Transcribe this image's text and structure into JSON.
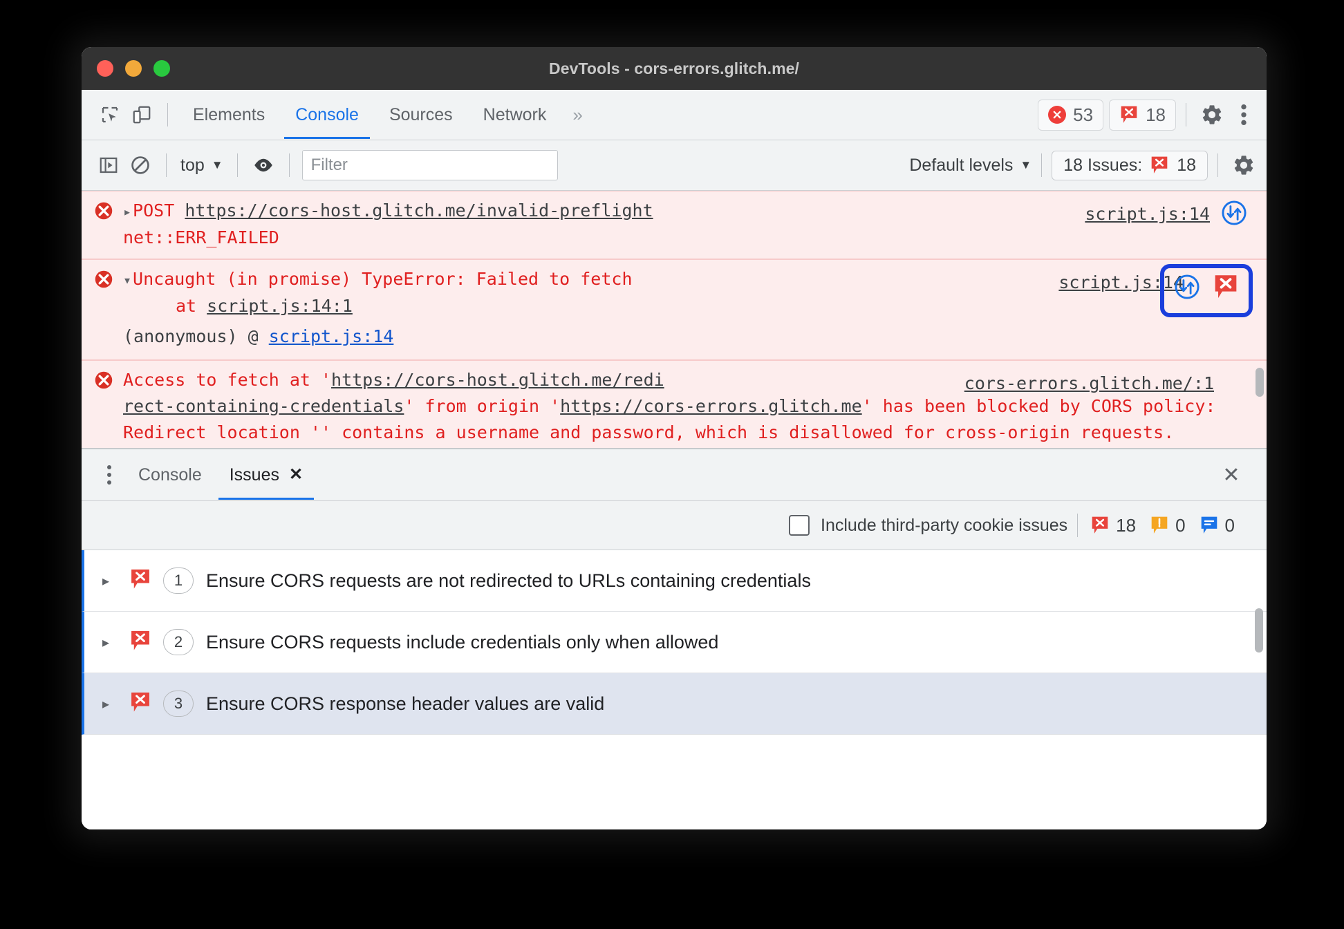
{
  "window": {
    "title": "DevTools - cors-errors.glitch.me/"
  },
  "main_tabs": {
    "items": [
      {
        "label": "Elements",
        "active": false
      },
      {
        "label": "Console",
        "active": true
      },
      {
        "label": "Sources",
        "active": false
      },
      {
        "label": "Network",
        "active": false
      }
    ],
    "overflow_label": "»",
    "error_count": "53",
    "issue_count": "18"
  },
  "console_toolbar": {
    "context": "top",
    "context_caret": "▼",
    "filter_placeholder": "Filter",
    "filter_value": "",
    "levels_label": "Default levels",
    "levels_caret": "▼",
    "issues_label": "18 Issues:",
    "issues_count": "18"
  },
  "console_messages": [
    {
      "expander": "▸",
      "method": "POST",
      "url": "https://cors-host.glitch.me/invalid-preflight",
      "detail": "net::ERR_FAILED",
      "source": "script.js:14"
    },
    {
      "expander": "▾",
      "text": "Uncaught (in promise) TypeError: Failed to fetch",
      "stack_prefix": "at",
      "stack_link": "script.js:14:1",
      "frame_label": "(anonymous) @",
      "frame_link": "script.js:14",
      "source": "script.js:14"
    },
    {
      "part1": "Access to fetch at '",
      "url_part1": "https://cors-host.glitch.me/redi",
      "url_part2": "rect-containing-credentials",
      "part2": "' from origin '",
      "origin": "https://cors-errors.glitch.me",
      "part3": "' has been blocked by CORS policy: Redirect location '' contains a username and password, which is disallowed for cross-origin requests.",
      "source": "cors-errors.glitch.me/:1"
    }
  ],
  "drawer": {
    "tabs": [
      {
        "label": "Console",
        "active": false,
        "closable": false
      },
      {
        "label": "Issues",
        "active": true,
        "closable": true,
        "close_glyph": "✕"
      }
    ],
    "close_glyph": "✕"
  },
  "issues_toolbar": {
    "checkbox_label": "Include third-party cookie issues",
    "checkbox_checked": false,
    "error_count": "18",
    "warning_count": "0",
    "info_count": "0"
  },
  "issues": [
    {
      "caret": "▸",
      "count": "1",
      "title": "Ensure CORS requests are not redirected to URLs containing credentials",
      "selected": false
    },
    {
      "caret": "▸",
      "count": "2",
      "title": "Ensure CORS requests include credentials only when allowed",
      "selected": false
    },
    {
      "caret": "▸",
      "count": "3",
      "title": "Ensure CORS response header values are valid",
      "selected": true
    }
  ],
  "colors": {
    "error_red": "#ee3e3a",
    "issue_red": "#e8443c",
    "warning_orange": "#f5a623",
    "info_blue": "#1a73e8",
    "accent_blue": "#1a73e8",
    "highlight_blue": "#1a3edc",
    "message_bg": "#fdeded",
    "console_text_red": "#e02020"
  }
}
